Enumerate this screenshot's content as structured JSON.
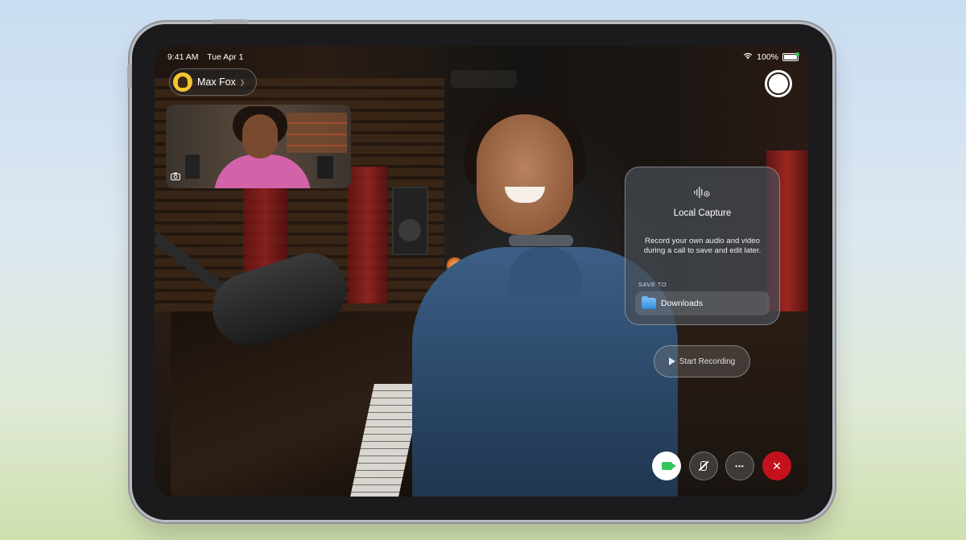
{
  "status_bar": {
    "time": "9:41 AM",
    "date": "Tue Apr 1",
    "battery": "100%"
  },
  "contact": {
    "name": "Max Fox",
    "chevron": "〉"
  },
  "local_capture": {
    "title": "Local Capture",
    "description": "Record your own audio and video during a call to save and edit later.",
    "save_to_label": "SAVE TO",
    "destination": "Downloads"
  },
  "record_button": {
    "label": "Start Recording"
  },
  "controls": {
    "more_glyph": "•••",
    "end_glyph": "✕"
  },
  "colors": {
    "accent_green": "#34c759",
    "end_call_red": "#c3121d",
    "folder_blue": "#2e8de0"
  },
  "icons": {
    "wifi": "wifi-icon",
    "battery": "battery-icon",
    "camera": "camera-icon",
    "waveform": "waveform-icon",
    "folder": "folder-icon",
    "play": "play-icon",
    "video": "video-icon",
    "mic_off": "mic-off-icon",
    "more": "more-icon",
    "close": "close-icon"
  }
}
